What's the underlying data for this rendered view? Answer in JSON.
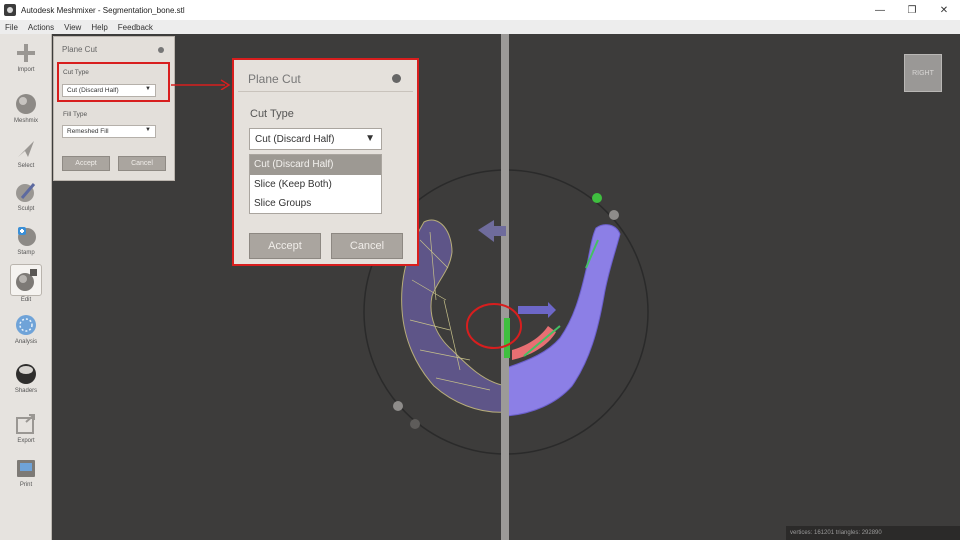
{
  "window": {
    "title": "Autodesk Meshmixer - Segmentation_bone.stl",
    "controls": [
      "—",
      "❐",
      "✕"
    ]
  },
  "menu": [
    "File",
    "Actions",
    "View",
    "Help",
    "Feedback"
  ],
  "toolbar": {
    "items": [
      {
        "label": "Import",
        "icon": "plus-icon"
      },
      {
        "label": "Meshmix",
        "icon": "sphere-icon"
      },
      {
        "label": "Select",
        "icon": "arrow-select-icon"
      },
      {
        "label": "Sculpt",
        "icon": "brush-icon"
      },
      {
        "label": "Stamp",
        "icon": "stamp-icon"
      },
      {
        "label": "Edit",
        "icon": "edit-icon"
      },
      {
        "label": "Analysis",
        "icon": "analysis-icon"
      },
      {
        "label": "Shaders",
        "icon": "shader-sphere-icon"
      },
      {
        "label": "Export",
        "icon": "export-icon"
      },
      {
        "label": "Print",
        "icon": "print-icon"
      }
    ],
    "active": "Edit"
  },
  "plane_cut_panel": {
    "title": "Plane Cut",
    "cut_type_label": "Cut Type",
    "cut_type_value": "Cut (Discard Half)",
    "fill_type_label": "Fill Type",
    "fill_type_value": "Remeshed Fill",
    "accept_label": "Accept",
    "cancel_label": "Cancel"
  },
  "zoom_panel": {
    "title": "Plane Cut",
    "cut_type_label": "Cut Type",
    "cut_type_value": "Cut (Discard Half)",
    "options": [
      "Cut (Discard Half)",
      "Slice (Keep Both)",
      "Slice Groups"
    ],
    "selected_index": 0,
    "accept_label": "Accept",
    "cancel_label": "Cancel"
  },
  "view_cube": {
    "label": "RIGHT"
  },
  "status": {
    "text": "vertices: 161201 triangles: 292890"
  },
  "colors": {
    "viewport_bg": "#3d3c3b",
    "mesh": "#8c7fe6",
    "highlight": "#d81e1e",
    "cut_plane": "#9c9a98",
    "gizmo_green": "#3fbf3f"
  }
}
